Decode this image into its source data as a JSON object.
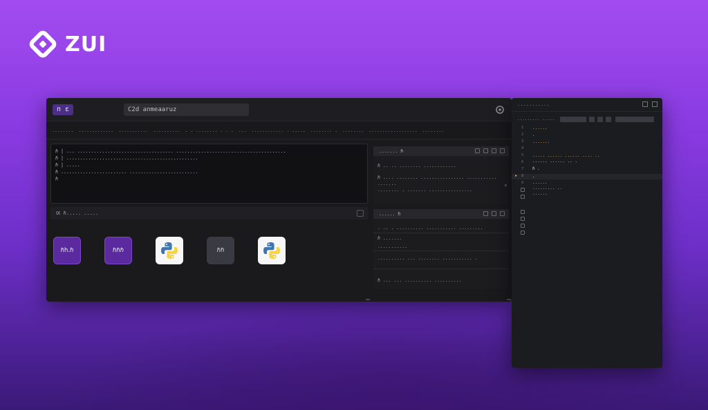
{
  "brand": {
    "name": "ZUI"
  },
  "colors": {
    "accent": "#8a3be2",
    "panel": "#1a1a1d",
    "code_keyword": "#d9a25a",
    "code_plain": "#cfcfd4"
  },
  "main": {
    "workspace_badge": "n  ε",
    "workspace_name": "C2d anmeaaruz",
    "tabs": [
      "........",
      ".............",
      "...........",
      "..........",
      ". . ........ . . .",
      "...",
      "............ . .....",
      "........ .",
      "........",
      "..................",
      "........"
    ],
    "output_lines": [
      "ℏ  | ... ................................... ........................................",
      "ℏ  | ................................................",
      "ℏ  |            .....",
      "ℏ  ........................ .........................",
      "ℏ"
    ],
    "launcher": {
      "title": "Ⅸ ℏ.....  .....",
      "tiles": [
        {
          "label": "ℏh.ℏ",
          "icon": "kernel-icon"
        },
        {
          "label": "ℏℏℏ",
          "icon": "kernel-icon"
        },
        {
          "label": "",
          "icon": "python-icon"
        },
        {
          "label": "ℏℏ",
          "icon": "terminal-icon"
        },
        {
          "label": "",
          "icon": "python-icon"
        }
      ]
    },
    "panel_top": {
      "title": ".......  ℏ",
      "lines": [
        "ℏ .. .. ........ ............",
        "ℏ .... ........ ................ ...........",
        "  .......",
        "........ . ....... ................"
      ]
    },
    "panel_bottom": {
      "title": "......  ℏ",
      "lines": [
        ". .. . .......... ........... .........",
        "ℏ .......",
        "...........",
        ".......... ... ........ ........... .",
        "ℏ ... ... .......... .........."
      ]
    }
  },
  "editor": {
    "title": "...........",
    "file": "......... .....",
    "line_numbers": [
      "1",
      "2",
      "3",
      "4",
      "5",
      "6",
      "7",
      "8",
      "9"
    ],
    "code_lines": [
      {
        "text": "......",
        "color": "#d9a25a"
      },
      {
        "text": ".",
        "color": "#cfcfd4"
      },
      {
        "text": ".......",
        "color": "#d9a25a"
      },
      {
        "text": "",
        "color": "#cfcfd4"
      },
      {
        "text": "..... ...... ...... ....  ..",
        "color": "#d9a25a"
      },
      {
        "text": "...... ......  ..  .",
        "color": "#cfcfd4"
      },
      {
        "text": "  ℏ  .",
        "color": "#cfcfd4"
      },
      {
        "text": ".",
        "color": "#cfcfd4"
      },
      {
        "text": "  ......",
        "color": "#d9a25a"
      },
      {
        "text": "    .........  ..",
        "color": "#d9a25a"
      },
      {
        "text": "  ......",
        "color": "#d9a25a"
      }
    ]
  }
}
